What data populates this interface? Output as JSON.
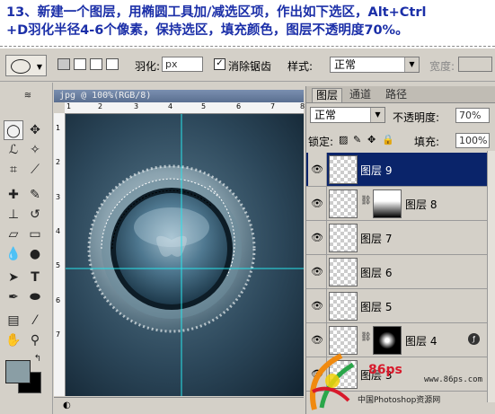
{
  "instruction": {
    "line1": "13、新建一个图层，用椭圆工具加/减选区项，作出如下选区，Alt+Ctrl",
    "line2": "+D羽化半径4-6个像素，保持选区，填充颜色，图层不透明度70%。"
  },
  "options_bar": {
    "feather_label": "羽化:",
    "feather_value": "px",
    "antialias_label": "消除锯齿",
    "antialias_checked": "✓",
    "style_label": "样式:",
    "style_value": "正常",
    "width_label": "宽度:"
  },
  "document": {
    "title": "jpg @ 100%(RGB/8)",
    "ruler_marks": [
      "1",
      "2",
      "3",
      "4",
      "5",
      "6",
      "7",
      "8"
    ],
    "ruler_v_marks": [
      "1",
      "2",
      "3",
      "4",
      "5",
      "6",
      "7"
    ]
  },
  "layers_panel": {
    "tabs": [
      "图层",
      "通道",
      "路径"
    ],
    "blend_mode": "正常",
    "opacity_label": "不透明度:",
    "opacity_value": "70%",
    "lock_label": "锁定:",
    "fill_label": "填充:",
    "fill_value": "100%",
    "layers": [
      {
        "name": "图层 9",
        "selected": true
      },
      {
        "name": "图层 8",
        "selected": false
      },
      {
        "name": "图层 7",
        "selected": false
      },
      {
        "name": "图层 6",
        "selected": false
      },
      {
        "name": "图层 5",
        "selected": false
      },
      {
        "name": "图层 4",
        "selected": false
      },
      {
        "name": "图层 3",
        "selected": false
      }
    ]
  },
  "watermark": {
    "url": "www.86ps.com",
    "site": "中国Photoshop资源网",
    "logo": "86ps"
  },
  "colors": {
    "foreground": "#8a9ea5",
    "background": "#000000",
    "selected_layer": "#0a246a"
  }
}
